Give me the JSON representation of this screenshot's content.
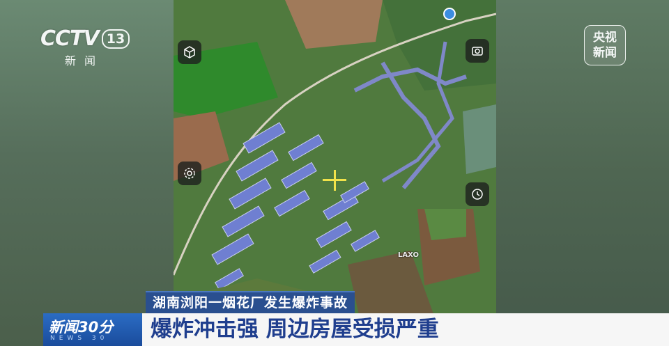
{
  "broadcaster": {
    "logo_text": "CCTV",
    "channel_number": "13",
    "channel_sub": "新闻",
    "corner_badge_line1": "央视",
    "corner_badge_line2": "新闻"
  },
  "map": {
    "place_label": "LAXO",
    "buttons": [
      {
        "icon": "cube-3d-icon"
      },
      {
        "icon": "camera-icon"
      },
      {
        "icon": "settings-gear-icon"
      },
      {
        "icon": "clock-icon"
      }
    ]
  },
  "captions": {
    "headline_top": "湖南浏阳一烟花厂发生爆炸事故",
    "program_name": "新闻30分",
    "program_sub": "NEWS 30",
    "headline_main": "爆炸冲击强 周边房屋受损严重"
  },
  "colors": {
    "headline_top_bg": "#2a4f8f",
    "program_bg": "#1a4c9c",
    "headline_main_text": "#1f3e8e",
    "crosshair": "#f1e24a"
  }
}
